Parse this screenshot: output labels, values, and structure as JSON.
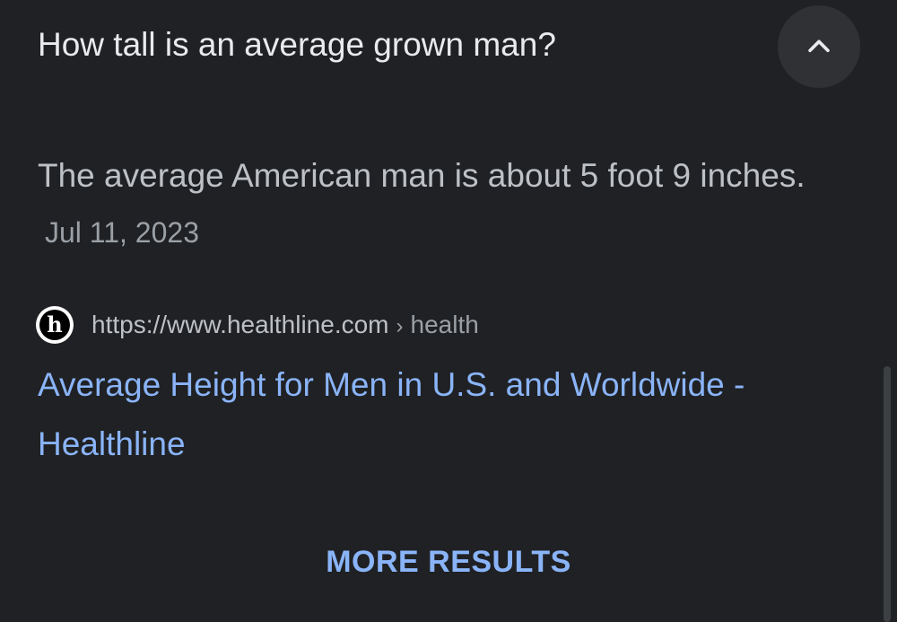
{
  "question": {
    "text": "How tall is an average grown man?"
  },
  "collapse_button": {
    "icon": "chevron-up-icon"
  },
  "answer": {
    "text": "The average American man is about 5 foot 9 inches.",
    "date": "Jul 11, 2023"
  },
  "source": {
    "favicon_letter": "h",
    "url": "https://www.healthline.com",
    "separator": "›",
    "path": "health"
  },
  "result": {
    "title": "Average Height for Men in U.S. and Worldwide - Healthline"
  },
  "more_results": {
    "label": "MORE RESULTS"
  },
  "colors": {
    "background": "#202124",
    "link": "#8ab4f8",
    "text_primary": "#e8eaed",
    "text_secondary": "#bdc1c6"
  }
}
